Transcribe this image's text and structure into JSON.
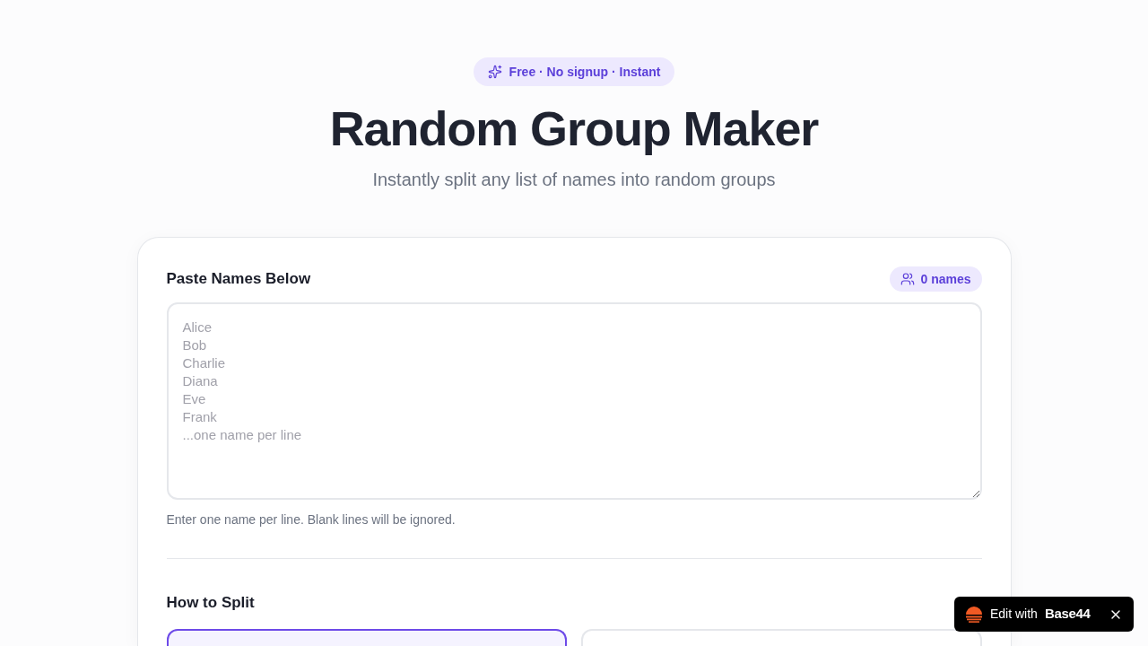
{
  "hero": {
    "badge": "Free · No signup · Instant",
    "title": "Random Group Maker",
    "subtitle": "Instantly split any list of names into random groups"
  },
  "names_section": {
    "heading": "Paste Names Below",
    "count": "0 names",
    "textarea": {
      "placeholder": "Alice\nBob\nCharlie\nDiana\nEve\nFrank\n...one name per line"
    },
    "hint": "Enter one name per line. Blank lines will be ignored."
  },
  "split_section": {
    "heading": "How to Split",
    "options": [
      {
        "selected": true
      },
      {
        "selected": false
      }
    ]
  },
  "edit_badge": {
    "label": "Edit with",
    "brand": "Base44"
  }
}
